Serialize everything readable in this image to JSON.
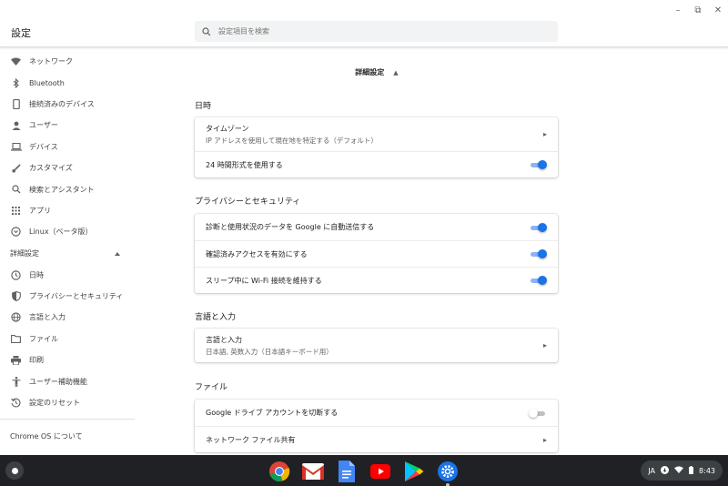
{
  "window": {
    "minimize": "–",
    "restore": "⧉",
    "close": "✕"
  },
  "header": {
    "title": "設定",
    "search_placeholder": "設定項目を検索"
  },
  "sidebar": {
    "items": [
      {
        "label": "ネットワーク",
        "icon": "wifi-icon"
      },
      {
        "label": "Bluetooth",
        "icon": "bluetooth-icon"
      },
      {
        "label": "接続済みのデバイス",
        "icon": "phone-icon"
      },
      {
        "label": "ユーザー",
        "icon": "person-icon"
      },
      {
        "label": "デバイス",
        "icon": "laptop-icon"
      },
      {
        "label": "カスタマイズ",
        "icon": "brush-icon"
      },
      {
        "label": "検索とアシスタント",
        "icon": "search-icon"
      },
      {
        "label": "アプリ",
        "icon": "apps-grid-icon"
      },
      {
        "label": "Linux（ベータ版）",
        "icon": "linux-icon"
      }
    ],
    "advanced_label": "詳細設定",
    "advanced_items": [
      {
        "label": "日時",
        "icon": "clock-icon"
      },
      {
        "label": "プライバシーとセキュリティ",
        "icon": "shield-icon"
      },
      {
        "label": "言語と入力",
        "icon": "globe-icon"
      },
      {
        "label": "ファイル",
        "icon": "folder-icon"
      },
      {
        "label": "印刷",
        "icon": "printer-icon"
      },
      {
        "label": "ユーザー補助機能",
        "icon": "accessibility-icon"
      },
      {
        "label": "設定のリセット",
        "icon": "reset-icon"
      }
    ],
    "about": "Chrome OS について"
  },
  "main": {
    "advanced_title": "詳細設定",
    "datetime": {
      "title": "日時",
      "timezone_label": "タイムゾーン",
      "timezone_sub": "IP アドレスを使用して現在地を特定する（デフォルト）",
      "clock24_label": "24 時間形式を使用する",
      "clock24_on": true
    },
    "privacy": {
      "title": "プライバシーとセキュリティ",
      "usage_label": "診断と使用状況のデータを Google に自動送信する",
      "usage_on": true,
      "verified_label": "確認済みアクセスを有効にする",
      "verified_on": true,
      "wifi_label": "スリープ中に Wi-Fi 接続を維持する",
      "wifi_on": true
    },
    "language": {
      "title": "言語と入力",
      "row_label": "言語と入力",
      "row_sub": "日本語, 英数入力（日本語キーボード用）"
    },
    "files": {
      "title": "ファイル",
      "gdrive_label": "Google ドライブ アカウントを切断する",
      "gdrive_on": false,
      "network_label": "ネットワーク ファイル共有"
    }
  },
  "shelf": {
    "apps": [
      "chrome-icon",
      "gmail-icon",
      "docs-icon",
      "youtube-icon",
      "play-store-icon",
      "settings-icon"
    ],
    "tray": {
      "ime": "JA",
      "time": "8:43"
    }
  },
  "colors": {
    "accent": "#1a73e8",
    "toggle_track_on": "#8ab4f8",
    "shelf": "#202124"
  }
}
